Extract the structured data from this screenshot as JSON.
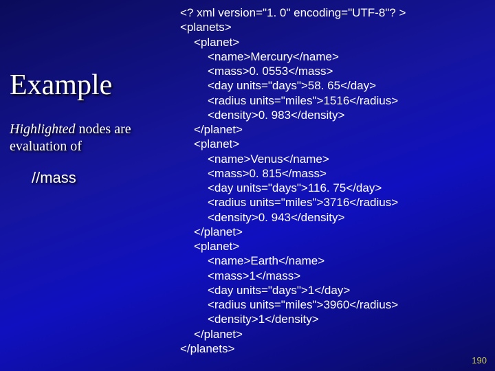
{
  "title": "Example",
  "subtitle": {
    "highlighted": "Highlighted",
    "rest": " nodes are evaluation of"
  },
  "xpath": "//mass",
  "code": {
    "decl": "<? xml version=\"1. 0\" encoding=\"UTF-8\"? >",
    "root_open": "<planets>",
    "root_close": "</planets>",
    "planet_open": "<planet>",
    "planet_close": "</planet>",
    "p1": {
      "name": "<name>Mercury</name>",
      "mass": "<mass>0. 0553</mass>",
      "day": "<day units=\"days\">58. 65</day>",
      "radius": "<radius units=\"miles\">1516</radius>",
      "density": "<density>0. 983</density>"
    },
    "p2": {
      "name": "<name>Venus</name>",
      "mass": "<mass>0. 815</mass>",
      "day": "<day units=\"days\">116. 75</day>",
      "radius": "<radius units=\"miles\">3716</radius>",
      "density": "<density>0. 943</density>"
    },
    "p3": {
      "name": "<name>Earth</name>",
      "mass": "<mass>1</mass>",
      "day": "<day units=\"days\">1</day>",
      "radius": "<radius units=\"miles\">3960</radius>",
      "density": "<density>1</density>"
    }
  },
  "page_number": "190"
}
